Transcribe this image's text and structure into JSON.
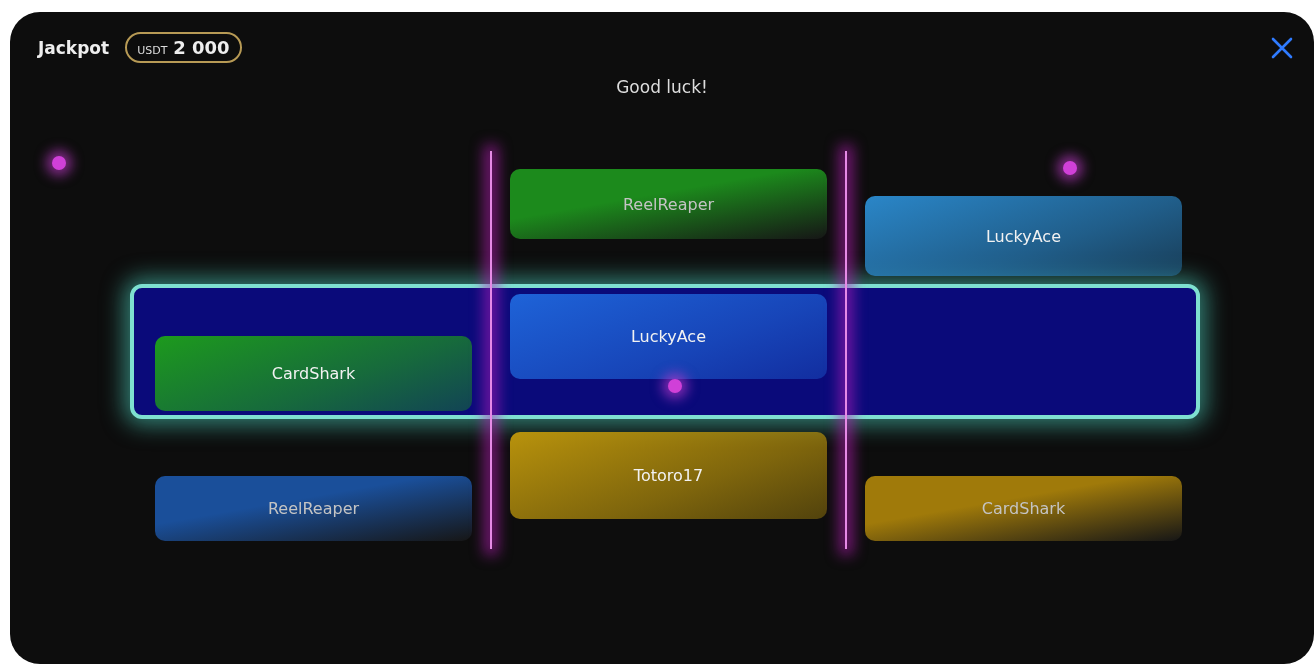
{
  "header": {
    "title": "Jackpot",
    "jackpot": {
      "currency": "USDT",
      "amount": "2 000"
    }
  },
  "message": "Good luck!",
  "reels": [
    {
      "cards": [
        {
          "name": "CardShark",
          "color": "#1d9a1d",
          "dimmed": false
        },
        {
          "name": "ReelReaper",
          "color": "#1a4f9a",
          "dimmed": true
        }
      ]
    },
    {
      "cards": [
        {
          "name": "ReelReaper",
          "color": "#1c8a1c",
          "dimmed": true
        },
        {
          "name": "LuckyAce",
          "color": "#1e63d8",
          "dimmed": false
        },
        {
          "name": "Totoro17",
          "color": "#b8920c",
          "dimmed": false
        }
      ]
    },
    {
      "cards": [
        {
          "name": "LuckyAce",
          "color": "#2a86c8",
          "dimmed": false
        },
        {
          "name": "CardShark",
          "color": "#a07a0a",
          "dimmed": true
        }
      ]
    }
  ]
}
